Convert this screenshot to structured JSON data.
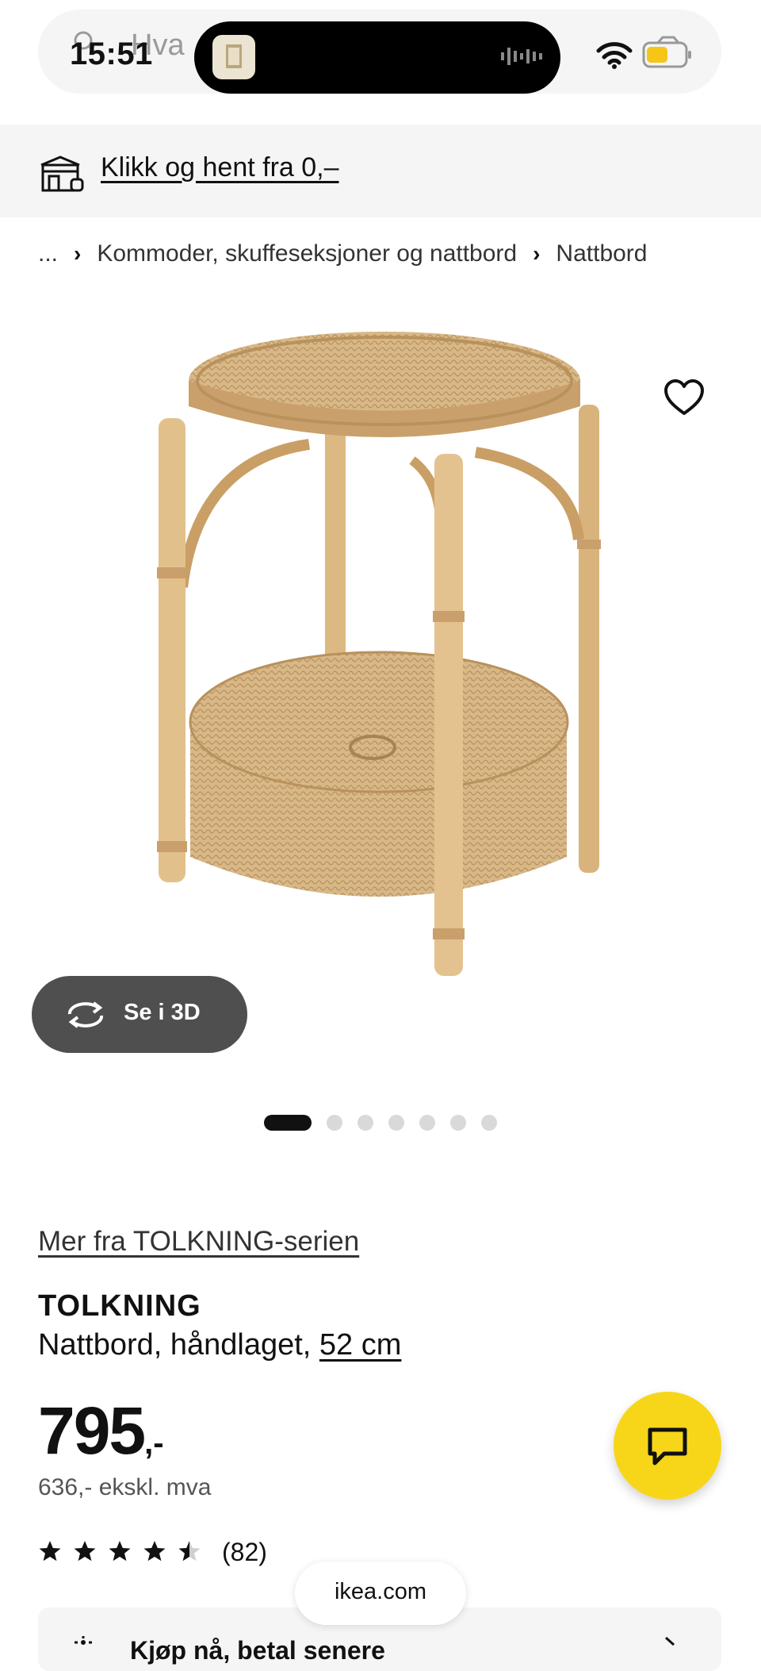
{
  "status_bar": {
    "time": "15:51",
    "search_placeholder": "Hva"
  },
  "promo": {
    "link_text": "Klikk og hent fra 0,–"
  },
  "breadcrumb": {
    "ellipsis": "...",
    "items": [
      "Kommoder, skuffeseksjoner og nattbord",
      "Nattbord"
    ]
  },
  "gallery": {
    "view_3d_label": "Se i 3D",
    "total_images": 7,
    "active_index": 0
  },
  "product": {
    "series_link": "Mer fra TOLKNING-serien",
    "name": "TOLKNING",
    "description": "Nattbord, håndlaget, ",
    "size": "52 cm",
    "price": "795",
    "price_suffix": ",-",
    "price_ex_vat": "636,- ekskl. mva",
    "rating": 4.5,
    "review_count": "(82)"
  },
  "bottom_card": {
    "label": "Kjøp nå, betal senere"
  },
  "browser": {
    "url": "ikea.com"
  },
  "colors": {
    "chat_yellow": "#f7d619",
    "pill_gray": "#f5f5f5",
    "button_dark": "#4f4f4f"
  }
}
